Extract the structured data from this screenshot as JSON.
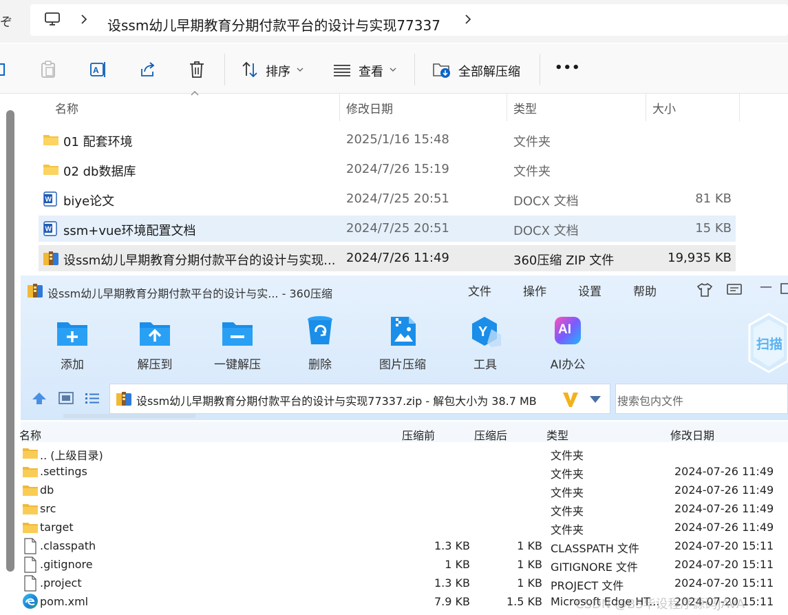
{
  "explorer": {
    "address": {
      "path_label": "设ssm幼儿早期教育分期付款平台的设计与实现77337"
    },
    "toolbar": {
      "sort_label": "排序",
      "view_label": "查看",
      "extract_all_label": "全部解压缩",
      "more_label": "•••"
    },
    "columns": {
      "name": "名称",
      "modified": "修改日期",
      "type": "类型",
      "size": "大小"
    },
    "files": [
      {
        "icon": "folder-icon",
        "name": "01 配套环境",
        "modified": "2025/1/16 15:48",
        "type": "文件夹",
        "size": ""
      },
      {
        "icon": "folder-icon",
        "name": "02 db数据库",
        "modified": "2024/7/26 15:19",
        "type": "文件夹",
        "size": ""
      },
      {
        "icon": "word-doc-icon",
        "name": "biye论文",
        "modified": "2024/7/25 20:51",
        "type": "DOCX 文档",
        "size": "81 KB"
      },
      {
        "icon": "word-doc-icon",
        "name": "ssm+vue环境配置文档",
        "modified": "2024/7/25 20:51",
        "type": "DOCX 文档",
        "size": "15 KB"
      },
      {
        "icon": "zip-archive-icon",
        "name": "设ssm幼儿早期教育分期付款平台的设计与实现...",
        "modified": "2024/7/26 11:49",
        "type": "360压缩 ZIP 文件",
        "size": "19,935 KB"
      }
    ]
  },
  "z360": {
    "title": "设ssm幼儿早期教育分期付款平台的设计与实... - 360压缩",
    "menu": [
      "文件",
      "操作",
      "设置",
      "帮助"
    ],
    "window_controls": {
      "minimize": "—"
    },
    "tools": [
      {
        "icon": "add-icon",
        "label": "添加"
      },
      {
        "icon": "extract-to-icon",
        "label": "解压到"
      },
      {
        "icon": "one-click-extract-icon",
        "label": "一键解压"
      },
      {
        "icon": "delete-icon",
        "label": "删除"
      },
      {
        "icon": "image-compress-icon",
        "label": "图片压缩"
      },
      {
        "icon": "tools-icon",
        "label": "工具"
      },
      {
        "icon": "ai-office-icon",
        "label": "AI办公"
      }
    ],
    "ai_badge": "AI",
    "scan_label": "扫描",
    "path_text": "设ssm幼儿早期教育分期付款平台的设计与实现77337.zip - 解包大小为 38.7 MB",
    "search_placeholder": "搜索包内文件",
    "columns": {
      "name": "名称",
      "before": "压缩前",
      "after": "压缩后",
      "type": "类型",
      "modified": "修改日期"
    },
    "entries": [
      {
        "icon": "folder-icon",
        "name": ".. (上级目录)",
        "before": "",
        "after": "",
        "type": "文件夹",
        "modified": ""
      },
      {
        "icon": "folder-icon",
        "name": ".settings",
        "before": "",
        "after": "",
        "type": "文件夹",
        "modified": "2024-07-26 11:49"
      },
      {
        "icon": "folder-icon",
        "name": "db",
        "before": "",
        "after": "",
        "type": "文件夹",
        "modified": "2024-07-26 11:49"
      },
      {
        "icon": "folder-icon",
        "name": "src",
        "before": "",
        "after": "",
        "type": "文件夹",
        "modified": "2024-07-26 11:49"
      },
      {
        "icon": "folder-icon",
        "name": "target",
        "before": "",
        "after": "",
        "type": "文件夹",
        "modified": "2024-07-26 11:49"
      },
      {
        "icon": "file-icon",
        "name": ".classpath",
        "before": "1.3 KB",
        "after": "1 KB",
        "type": "CLASSPATH 文件",
        "modified": "2024-07-20 15:11"
      },
      {
        "icon": "file-icon",
        "name": ".gitignore",
        "before": "1 KB",
        "after": "1 KB",
        "type": "GITIGNORE 文件",
        "modified": "2024-07-20 15:11"
      },
      {
        "icon": "file-icon",
        "name": ".project",
        "before": "1.3 KB",
        "after": "1 KB",
        "type": "PROJECT 文件",
        "modified": "2024-07-20 15:11"
      },
      {
        "icon": "edge-icon",
        "name": "pom.xml",
        "before": "7.9 KB",
        "after": "1.5 KB",
        "type": "Microsoft Edge HT...",
        "modified": "2024-07-20 15:11"
      }
    ]
  },
  "watermark": "CSDN @BS毕设程序源码JAVA"
}
